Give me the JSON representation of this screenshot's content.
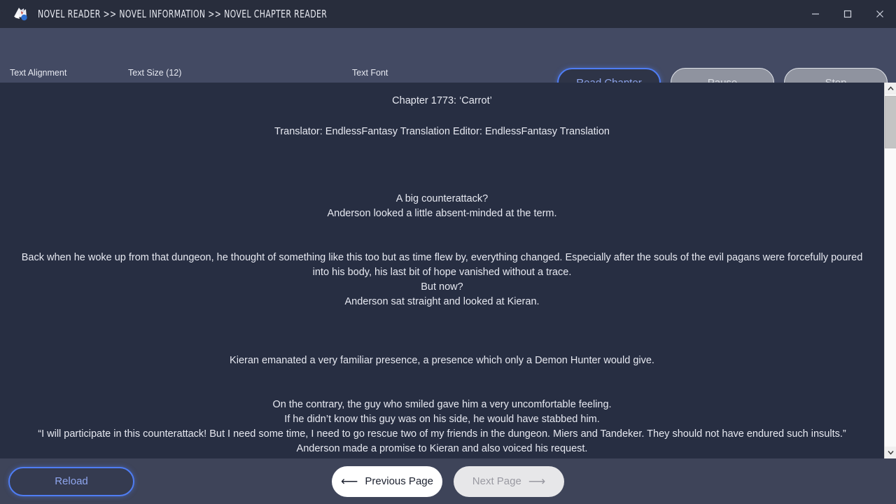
{
  "window": {
    "title": "NOVEL READER >> NOVEL INFORMATION >> NOVEL CHAPTER READER",
    "app_icon": "novel-reader-app-icon",
    "minimize": "—",
    "maximize": "☐",
    "close": "✕",
    "accent_blue": "#4f7df3",
    "accent_cyan": "#3cb8d4",
    "titlebar_bg": "#282d3c",
    "toolbar_bg": "#434a63",
    "content_bg": "#272e42",
    "bottombar_bg": "#3e4459"
  },
  "toolbar": {
    "alignment_label": "Text Alignment",
    "alignment_options": [
      "align-left",
      "align-center",
      "align-right"
    ],
    "text_size_label": "Text Size (12)",
    "text_size_value": 12,
    "text_size_percent": 12,
    "font_label": "Text Font",
    "font_value": "",
    "font_chevron": "⌄",
    "read_label": "Read Chapter",
    "pause_label": "Pause",
    "stop_label": "Stop"
  },
  "content": {
    "chapter_title": "Chapter 1773: ‘Carrot’",
    "credits": "Translator: EndlessFantasy Translation  Editor: EndlessFantasy Translation",
    "paragraphs": [
      "A big counterattack?",
      "Anderson looked a little absent-minded at the term.",
      "Back when he woke up from that dungeon, he thought of something like this too but as time flew by, everything changed. Especially after the souls of the evil pagans were forcefully poured into his body, his last bit of hope vanished without a trace.",
      "But now?",
      "Anderson sat straight and looked at Kieran.",
      "Kieran emanated a very familiar presence, a presence which only a Demon Hunter would give.",
      "On the contrary, the guy who smiled gave him a very uncomfortable feeling.",
      "If he didn’t know this guy was on his side, he would have stabbed him.",
      "“I will participate in this counterattack! But I need some time, I need to go rescue two of my friends in the dungeon. Miers and Tandeker. They should not have endured such insults.”",
      "Anderson made a promise to Kieran and also voiced his request."
    ]
  },
  "scrollbar": {
    "up_arrow": "⌃",
    "down_arrow": "⌄"
  },
  "footer": {
    "reload_label": "Reload",
    "prev_arrow": "⟵",
    "prev_label": "Previous Page",
    "next_label": "Next Page",
    "next_arrow": "⟶"
  }
}
